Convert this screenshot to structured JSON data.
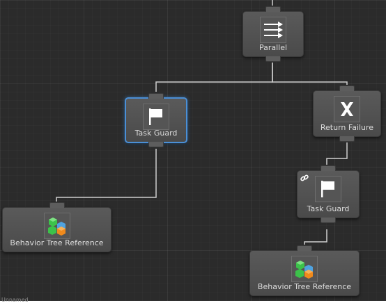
{
  "canvas": {
    "background": "#2b2b2b",
    "connector_color": "#cfcfcf",
    "selection_color": "#4a8fd6",
    "status_text": "Unnamed"
  },
  "nodes": {
    "parallel": {
      "label": "Parallel",
      "icon": "parallel-arrows-icon"
    },
    "task_guard_left": {
      "label": "Task Guard",
      "icon": "flag-icon",
      "selected": true
    },
    "return_failure": {
      "label": "Return Failure",
      "icon": "x-icon"
    },
    "task_guard_right": {
      "label": "Task Guard",
      "icon": "flag-icon",
      "badge": "link-icon"
    },
    "behavior_tree_reference_left": {
      "label": "Behavior Tree Reference",
      "icon": "behavior-tree-blocks-icon"
    },
    "behavior_tree_reference_right": {
      "label": "Behavior Tree Reference",
      "icon": "behavior-tree-blocks-icon"
    }
  }
}
